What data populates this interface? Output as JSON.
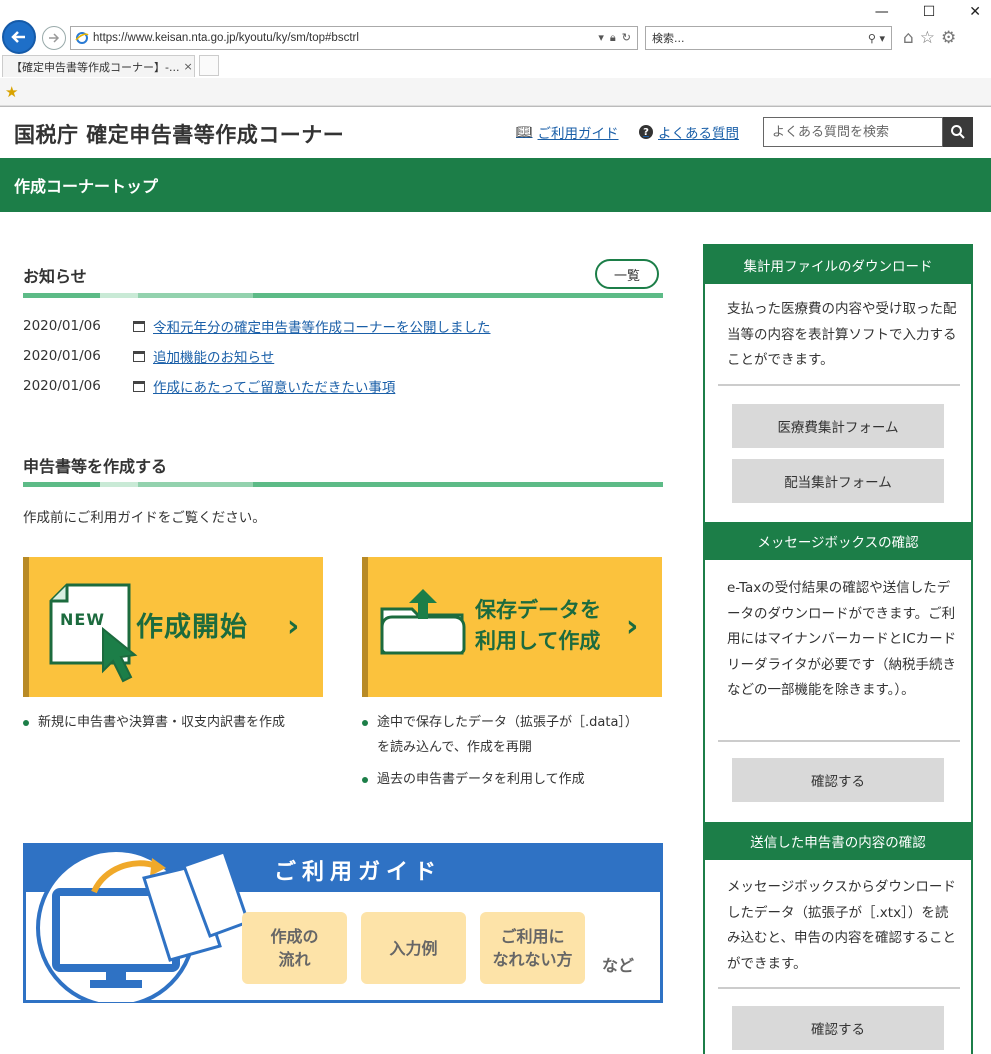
{
  "browser": {
    "url": "https://www.keisan.nta.go.jp/kyoutu/ky/sm/top#bsctrl",
    "search_placeholder": "検索...",
    "tab_title": "【確定申告書等作成コーナー】-...",
    "tab_close": "×"
  },
  "header": {
    "site_title": "国税庁 確定申告書等作成コーナー",
    "guide_link": "ご利用ガイド",
    "faq_link": "よくある質問",
    "faq_search_placeholder": "よくある質問を検索"
  },
  "breadcrumb_band": {
    "label": "作成コーナートップ"
  },
  "news": {
    "title": "お知らせ",
    "list_button": "一覧",
    "items": [
      {
        "date": "2020/01/06",
        "text": "令和元年分の確定申告書等作成コーナーを公開しました"
      },
      {
        "date": "2020/01/06",
        "text": "追加機能のお知らせ"
      },
      {
        "date": "2020/01/06",
        "text": "作成にあたってご留意いただきたい事項"
      }
    ]
  },
  "create": {
    "title": "申告書等を作成する",
    "intro": "作成前にご利用ガイドをご覧ください。",
    "start_button": {
      "badge": "NEW",
      "label": "作成開始"
    },
    "saved_button": {
      "label_line1": "保存データを",
      "label_line2": "利用して作成"
    },
    "start_bullets": [
      "新規に申告書や決算書・収支内訳書を作成"
    ],
    "saved_bullets": [
      {
        "line1": "途中で保存したデータ（拡張子が［.data］）",
        "line2": "を読み込んで、作成を再開"
      },
      {
        "line1": "過去の申告書データを利用して作成"
      }
    ]
  },
  "guide_banner": {
    "title": "ご利用ガイド",
    "chip1_l1": "作成の",
    "chip1_l2": "流れ",
    "chip2": "入力例",
    "chip3_l1": "ご利用に",
    "chip3_l2": "なれない方",
    "etc": "など"
  },
  "sidebar": {
    "download": {
      "title": "集計用ファイルのダウンロード",
      "text": "支払った医療費の内容や受け取った配当等の内容を表計算ソフトで入力することができます。",
      "button1": "医療費集計フォーム",
      "button2": "配当集計フォーム"
    },
    "messagebox": {
      "title": "メッセージボックスの確認",
      "text": "e-Taxの受付結果の確認や送信したデータのダウンロードができます。ご利用にはマイナンバーカードとICカードリーダライタが必要です（納税手続きなどの一部機能を除きます。）。",
      "button": "確認する"
    },
    "sent": {
      "title": "送信した申告書の内容の確認",
      "text": "メッセージボックスからダウンロードしたデータ（拡張子が［.xtx］）を読み込むと、申告の内容を確認することができます。",
      "button": "確認する"
    }
  }
}
